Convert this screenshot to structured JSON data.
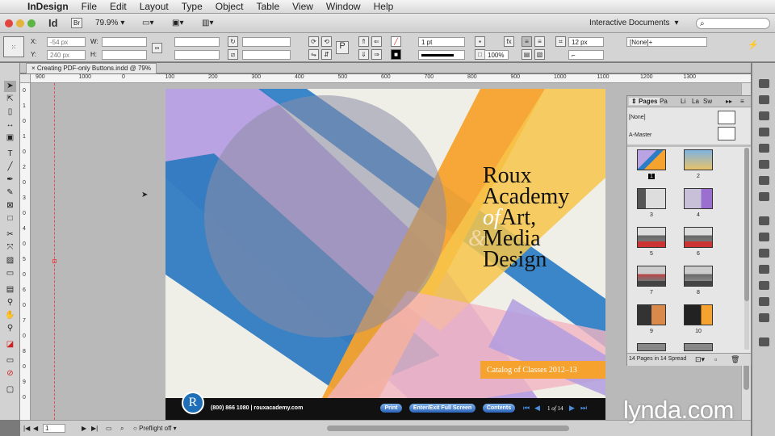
{
  "menubar": {
    "app_name": "InDesign",
    "items": [
      "File",
      "Edit",
      "Layout",
      "Type",
      "Object",
      "Table",
      "View",
      "Window",
      "Help"
    ]
  },
  "appbar": {
    "logo": "Id",
    "bridge": "Br",
    "zoom": "79.9%",
    "workspace": "Interactive Documents"
  },
  "control": {
    "x_label": "X:",
    "x_value": "-54 px",
    "y_label": "Y:",
    "y_value": "240 px",
    "w_label": "W:",
    "h_label": "H:",
    "stroke_weight": "1 pt",
    "opacity": "100%",
    "dim_value": "12 px",
    "style_value": "[None]+"
  },
  "document": {
    "tab_title": "Creating PDF-only Buttons.indd @ 79%"
  },
  "ruler_h": [
    "900",
    "1000",
    "0",
    "100",
    "200",
    "300",
    "400",
    "500",
    "600",
    "700",
    "800",
    "900",
    "1000",
    "1100",
    "1200",
    "1300"
  ],
  "ruler_v": [
    "0",
    "1",
    "0",
    "1",
    "0",
    "2",
    "0",
    "3",
    "0",
    "4",
    "0",
    "5",
    "0",
    "6",
    "0",
    "7",
    "0",
    "8",
    "0",
    "9",
    "0"
  ],
  "cover": {
    "line1": "Roux",
    "line2": "Academy",
    "line3_of": "of",
    "line3": "Art,",
    "line4_amp": "&",
    "line4": "Media",
    "line5": "Design",
    "catalog": "Catalog of Classes 2012–13",
    "logo_letter": "R",
    "phone": "(800) 866 1080",
    "site": "rouxacademy.com",
    "btn_print": "Print",
    "btn_fullscreen": "Enter/Exit Full Screen",
    "btn_contents": "Contents",
    "page_indicator_current": "1",
    "page_indicator_of": "of",
    "page_indicator_total": "14"
  },
  "pages_panel": {
    "tab_pages": "Pages",
    "tab_2": "Pa",
    "tab_3": "Li",
    "tab_4": "La",
    "tab_5": "Sw",
    "master_none": "[None]",
    "master_a": "A-Master",
    "page_numbers": [
      "1",
      "2",
      "3",
      "4",
      "5",
      "6",
      "7",
      "8",
      "9",
      "10"
    ],
    "footer": "14 Pages in 14 Spread"
  },
  "status": {
    "page": "1",
    "preflight": "Preflight off"
  },
  "watermark": "lynda.com",
  "colors": {
    "purple": "#b7a2e0",
    "blue": "#1f77c2",
    "orange": "#f5a02c",
    "yellow": "#f8c84a",
    "pink": "#f4b7c0",
    "circle": "#8a8aa0"
  }
}
